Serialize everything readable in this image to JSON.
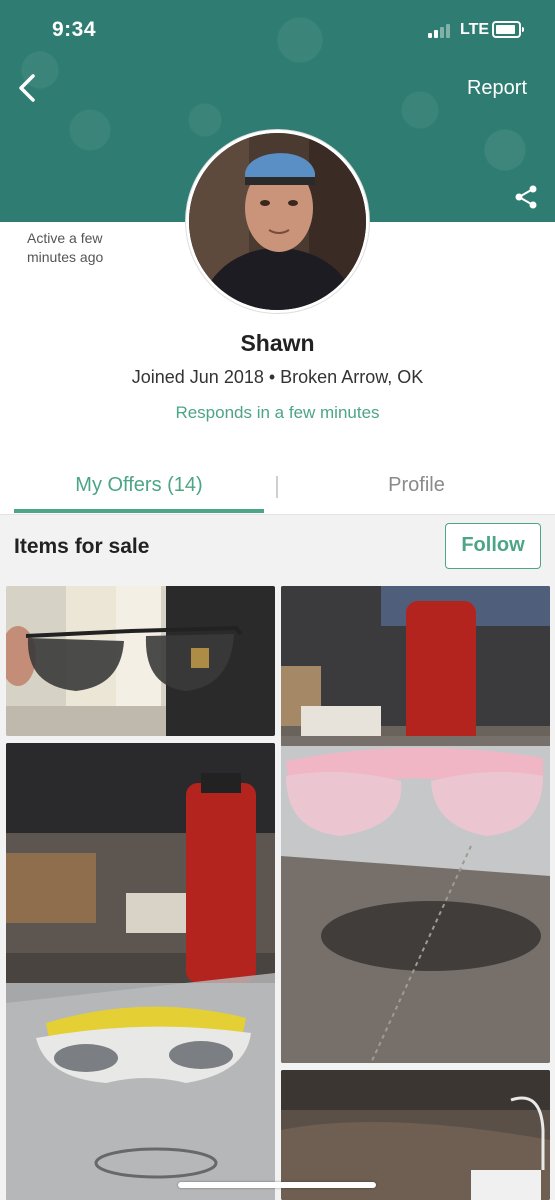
{
  "status_bar": {
    "time": "9:34",
    "network": "LTE"
  },
  "header": {
    "report_label": "Report",
    "active_text": "Active a few minutes ago"
  },
  "profile": {
    "name": "Shawn",
    "joined": "Joined Jun 2018 • Broken Arrow, OK",
    "responds": "Responds in a few minutes"
  },
  "tabs": [
    {
      "label": "My Offers (14)",
      "selected": true
    },
    {
      "label": "Profile",
      "selected": false
    }
  ],
  "items_section": {
    "title": "Items for sale",
    "follow_label": "Follow"
  },
  "colors": {
    "header_bg": "#2f7d72",
    "accent": "#4ca585"
  },
  "icons": [
    "chevron-left-icon",
    "share-icon",
    "signal-icon",
    "battery-icon"
  ]
}
